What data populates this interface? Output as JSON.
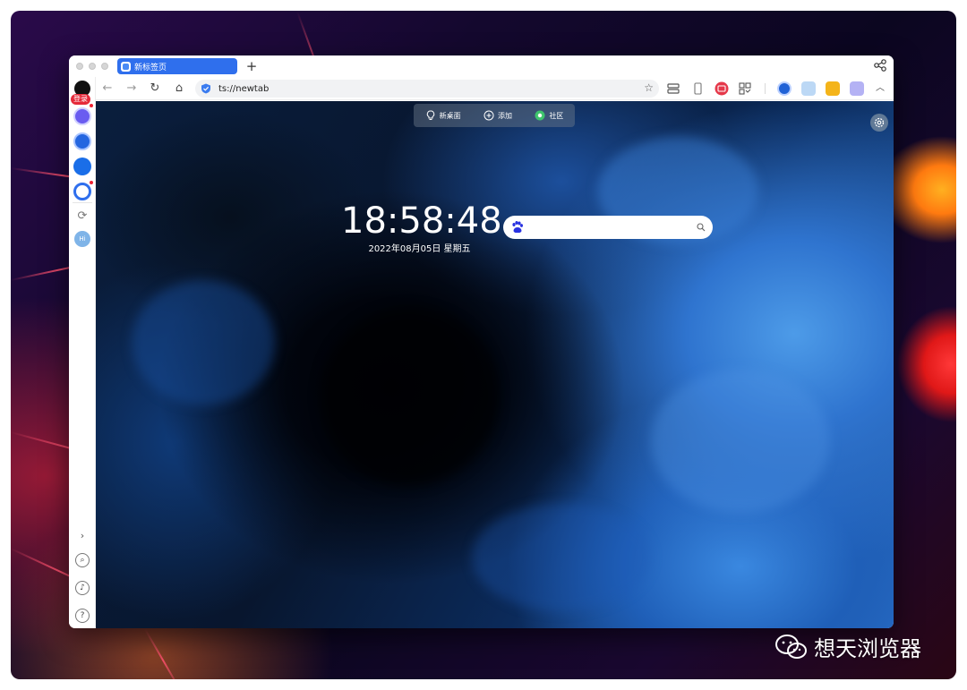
{
  "tab": {
    "title": "新标签页"
  },
  "toolbar": {
    "url": "ts://newtab"
  },
  "sidebar": {
    "login_label": "登录",
    "avatar_label": "Hi"
  },
  "newtab": {
    "nav": [
      {
        "label": "新桌面",
        "icon": "lightbulb-icon"
      },
      {
        "label": "添加",
        "icon": "plus-circle-icon"
      },
      {
        "label": "社区",
        "icon": "community-icon"
      }
    ],
    "time": "18:58:48",
    "date": "2022年08月05日  星期五",
    "search_placeholder": ""
  },
  "watermark": {
    "text": "想天浏览器"
  },
  "colors": {
    "tab_active": "#2f6fed",
    "login_badge": "#e52a3a",
    "search_bg": "#ffffff"
  }
}
